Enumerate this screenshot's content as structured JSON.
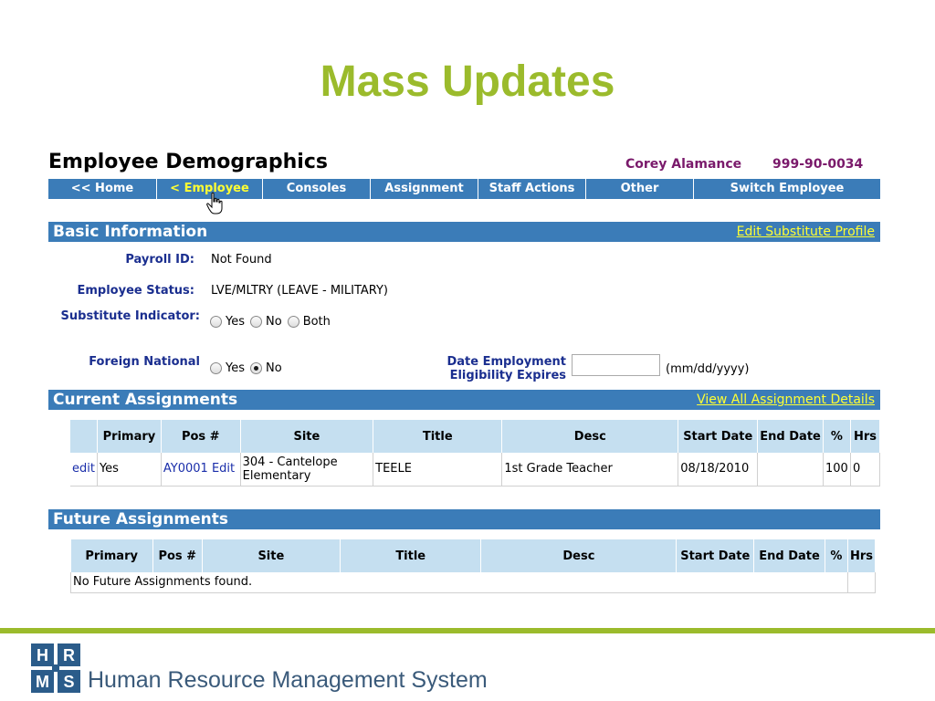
{
  "slide": {
    "title": "Mass Updates"
  },
  "app": {
    "title": "Employee Demographics",
    "employee_name": "Corey Alamance",
    "employee_ssn": "999-90-0034"
  },
  "nav": {
    "items": [
      {
        "label": "<< Home"
      },
      {
        "label": "< Employee",
        "active": true
      },
      {
        "label": "Consoles"
      },
      {
        "label": "Assignment"
      },
      {
        "label": "Staff Actions"
      },
      {
        "label": "Other"
      },
      {
        "label": "Switch Employee"
      }
    ]
  },
  "basic": {
    "header": "Basic Information",
    "edit_link": "Edit Substitute Profile",
    "payroll_label": "Payroll ID:",
    "payroll_value": "Not Found",
    "status_label": "Employee Status:",
    "status_value": "LVE/MLTRY (LEAVE - MILITARY)",
    "substitute_label": "Substitute Indicator:",
    "substitute_options": [
      "Yes",
      "No",
      "Both"
    ],
    "foreign_label": "Foreign National",
    "foreign_options": [
      "Yes",
      "No"
    ],
    "foreign_selected": "No",
    "date_label_line1": "Date Employment",
    "date_label_line2": "Eligibility Expires",
    "date_value": "",
    "date_format": "(mm/dd/yyyy)"
  },
  "current": {
    "header": "Current Assignments",
    "link": "View All Assignment Details",
    "columns": [
      "",
      "Primary",
      "Pos #",
      "Site",
      "Title",
      "Desc",
      "Start Date",
      "End Date",
      "%",
      "Hrs"
    ],
    "rows": [
      {
        "edit": "edit",
        "primary": "Yes",
        "pos": "AY0001",
        "pos_edit": "Edit",
        "site": "304 - Cantelope Elementary",
        "title": "TEELE",
        "desc": "1st Grade Teacher",
        "start": "08/18/2010",
        "end": "",
        "pct": "100",
        "hrs": "0"
      }
    ]
  },
  "future": {
    "header": "Future Assignments",
    "columns": [
      "Primary",
      "Pos #",
      "Site",
      "Title",
      "Desc",
      "Start Date",
      "End Date",
      "%",
      "Hrs"
    ],
    "empty": "No Future Assignments found."
  },
  "footer": {
    "logo_letters": [
      "H",
      "R",
      "M",
      "S"
    ],
    "text": "Human Resource Management System",
    "accent": "#9bbb2c",
    "logo_color": "#2b5c8a"
  }
}
